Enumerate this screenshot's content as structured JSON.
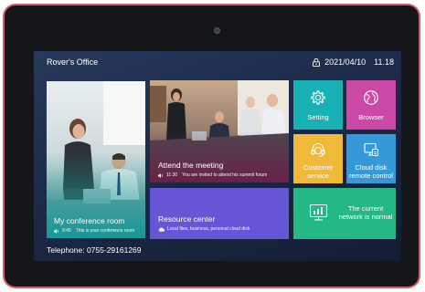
{
  "header": {
    "office_name": "Rover's Office",
    "date": "2021/04/10",
    "time": "11.18"
  },
  "tiles": {
    "conference": {
      "title": "My conference room",
      "time": "9:45",
      "message": "This is your conference room"
    },
    "meeting": {
      "title": "Attend the meeting",
      "time": "11:30",
      "message": "You are invited to attend his summit forum"
    },
    "resource": {
      "title": "Resource center",
      "message": "Local files, business, personal cloud disk"
    },
    "setting": {
      "label": "Setting",
      "icon": "gear-icon"
    },
    "browser": {
      "label": "Browser",
      "icon": "globe-icon"
    },
    "customer": {
      "label_line1": "Customer",
      "label_line2": "service",
      "icon": "headset-icon"
    },
    "cloud": {
      "label_line1": "Cloud disk",
      "label_line2": "remote control",
      "icon": "cloud-monitor-icon"
    },
    "network": {
      "label_line1": "The current",
      "label_line2": "network is normal",
      "icon": "network-chart-icon"
    }
  },
  "footer": {
    "telephone": "Telephone: 0755-29161269"
  },
  "colors": {
    "setting": "#18b1b4",
    "browser": "#cc48a6",
    "customer": "#f1b93a",
    "cloud": "#3599d8",
    "network": "#23b884",
    "resource": "#6556d6",
    "device_frame": "#d85a68"
  }
}
